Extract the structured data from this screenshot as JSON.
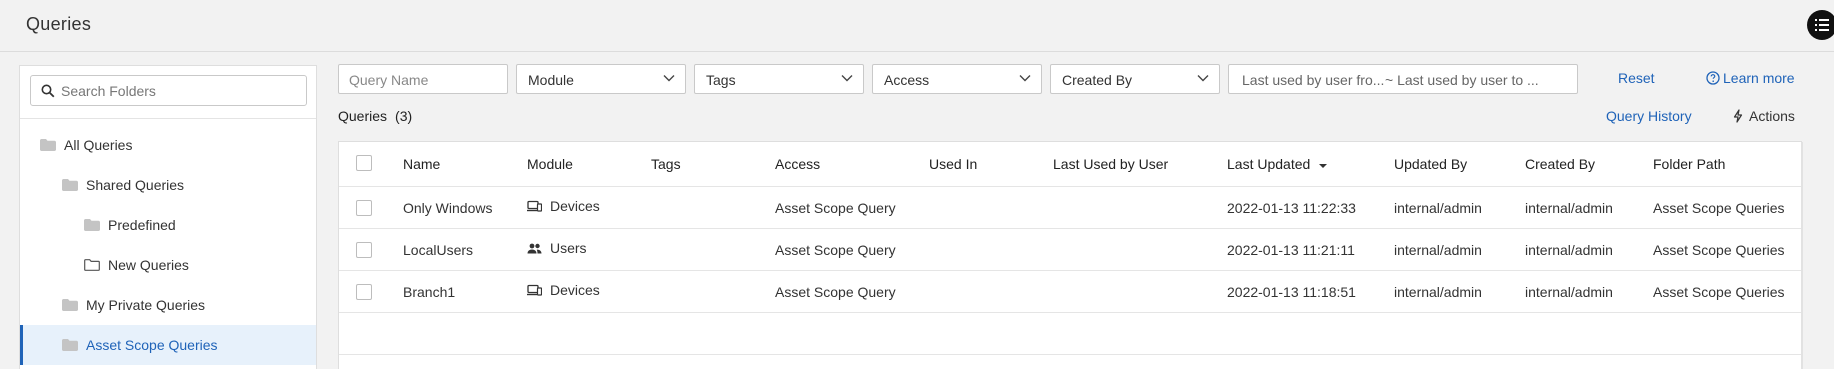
{
  "header": {
    "title": "Queries"
  },
  "sidebar": {
    "search_placeholder": "Search Folders",
    "items": [
      {
        "label": "All Queries"
      },
      {
        "label": "Shared Queries"
      },
      {
        "label": "Predefined"
      },
      {
        "label": "New Queries"
      },
      {
        "label": "My Private Queries"
      },
      {
        "label": "Asset Scope Queries",
        "selected": true
      }
    ]
  },
  "filters": {
    "query_name_placeholder": "Query Name",
    "module": "Module",
    "tags": "Tags",
    "access": "Access",
    "created_by": "Created By",
    "last_used_from": "Last used by user fro...",
    "last_used_to": "~ Last used by user to ...",
    "reset": "Reset",
    "learn_more": "Learn more"
  },
  "list": {
    "title": "Queries",
    "count": "(3)",
    "query_history": "Query History",
    "actions": "Actions"
  },
  "table": {
    "columns": [
      "Name",
      "Module",
      "Tags",
      "Access",
      "Used In",
      "Last Used by User",
      "Last Updated",
      "Updated By",
      "Created By",
      "Folder Path"
    ],
    "sorted_column": "Last Updated",
    "rows": [
      {
        "name": "Only Windows",
        "module": "Devices",
        "module_icon": "devices-icon",
        "tags": "",
        "access": "Asset Scope Query",
        "used_in": "",
        "last_used": "",
        "last_updated": "2022-01-13 11:22:33",
        "updated_by": "internal/admin",
        "created_by": "internal/admin",
        "folder_path": "Asset Scope Queries"
      },
      {
        "name": "LocalUsers",
        "module": "Users",
        "module_icon": "users-icon",
        "tags": "",
        "access": "Asset Scope Query",
        "used_in": "",
        "last_used": "",
        "last_updated": "2022-01-13 11:21:11",
        "updated_by": "internal/admin",
        "created_by": "internal/admin",
        "folder_path": "Asset Scope Queries"
      },
      {
        "name": "Branch1",
        "module": "Devices",
        "module_icon": "devices-icon",
        "tags": "",
        "access": "Asset Scope Query",
        "used_in": "",
        "last_used": "",
        "last_updated": "2022-01-13 11:18:51",
        "updated_by": "internal/admin",
        "created_by": "internal/admin",
        "folder_path": "Asset Scope Queries"
      }
    ]
  },
  "colors": {
    "accent": "#1f63b8",
    "selected_bg": "#e7f1fb",
    "background": "#f2f2f2"
  }
}
